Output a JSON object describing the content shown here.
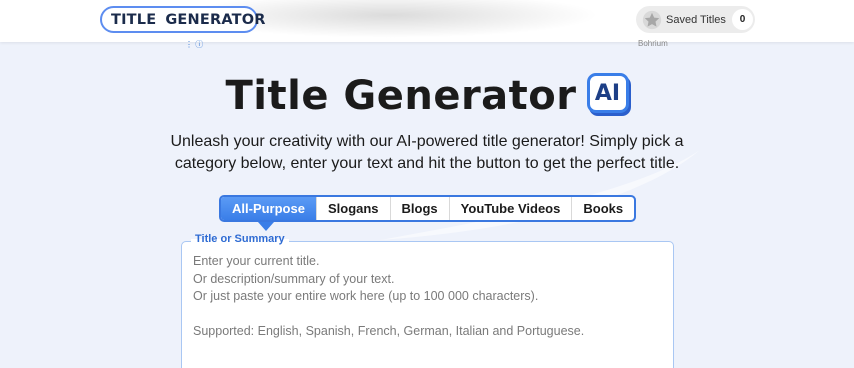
{
  "header": {
    "logo_left": "TITLE",
    "logo_right": "GENERATOR",
    "saved_label": "Saved Titles",
    "saved_count": "0",
    "ad_label": "Bohrium",
    "ad_icons": "⋮ ⓘ"
  },
  "hero": {
    "title": "Title Generator",
    "badge": "AI",
    "subtitle": "Unleash your creativity with our AI-powered title generator! Simply pick a category below, enter your text and hit the button to get the perfect title."
  },
  "tabs": [
    {
      "label": "All-Purpose",
      "active": true
    },
    {
      "label": "Slogans",
      "active": false
    },
    {
      "label": "Blogs",
      "active": false
    },
    {
      "label": "YouTube Videos",
      "active": false
    },
    {
      "label": "Books",
      "active": false
    }
  ],
  "input": {
    "legend": "Title or Summary",
    "placeholder": "Enter your current title.\nOr description/summary of your text.\nOr just paste your entire work here (up to 100 000 characters).\n\nSupported: English, Spanish, French, German, Italian and Portuguese."
  },
  "colors": {
    "accent": "#3a7ee8",
    "background": "#eef2fb"
  }
}
